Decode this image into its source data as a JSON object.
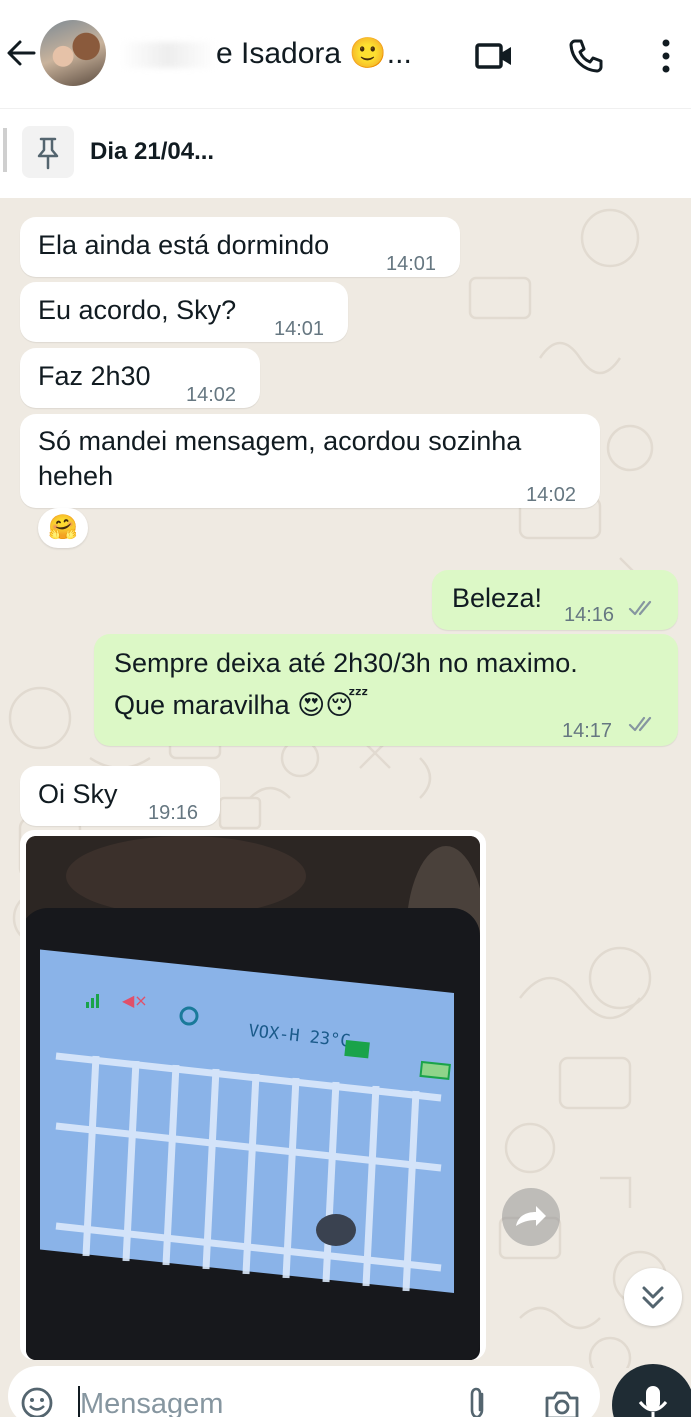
{
  "header": {
    "contact_name": "e Isadora 🙂...",
    "avatar_label": "avatar"
  },
  "pinned": {
    "text": "Dia 21/04..."
  },
  "messages": [
    {
      "direction": "in",
      "text": "Ela ainda está dormindo",
      "time": "14:01"
    },
    {
      "direction": "in",
      "text": "Eu acordo, Sky?",
      "time": "14:01"
    },
    {
      "direction": "in",
      "text": "Faz 2h30",
      "time": "14:02"
    },
    {
      "direction": "in",
      "text_line1": "Só mandei mensagem, acordou sozinha",
      "text_line2": "heheh",
      "time": "14:02",
      "reaction": "🤗"
    },
    {
      "direction": "out",
      "text": "Beleza!",
      "time": "14:16",
      "status": "read"
    },
    {
      "direction": "out",
      "text_line1": "Sempre deixa até 2h30/3h no maximo.",
      "text_line2": "Que maravilha 😍😴",
      "time": "14:17",
      "status": "read"
    },
    {
      "direction": "in",
      "text": "Oi Sky",
      "time": "19:16"
    },
    {
      "direction": "in",
      "type": "image",
      "image_overlay": "VOX-H 23°C"
    }
  ],
  "input": {
    "placeholder": "Mensagem"
  },
  "colors": {
    "incoming_bubble": "#ffffff",
    "outgoing_bubble": "#dcf8c6",
    "read_ticks": "#8696a0",
    "chat_background": "#efeae2",
    "mic_button": "#1f2c34"
  }
}
